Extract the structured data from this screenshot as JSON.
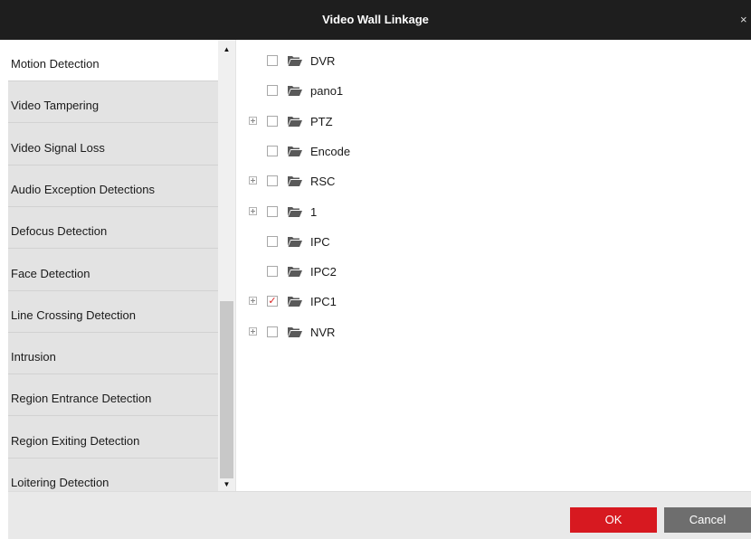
{
  "dialog": {
    "title": "Video Wall Linkage",
    "close_glyph": "×"
  },
  "sidebar": {
    "items": [
      {
        "label": "Motion Detection",
        "active": true
      },
      {
        "label": "Video Tampering",
        "active": false
      },
      {
        "label": "Video Signal Loss",
        "active": false
      },
      {
        "label": "Audio Exception Detections",
        "active": false
      },
      {
        "label": "Defocus Detection",
        "active": false
      },
      {
        "label": "Face Detection",
        "active": false
      },
      {
        "label": "Line Crossing Detection",
        "active": false
      },
      {
        "label": "Intrusion",
        "active": false
      },
      {
        "label": "Region Entrance Detection",
        "active": false
      },
      {
        "label": "Region Exiting Detection",
        "active": false
      },
      {
        "label": "Loitering Detection",
        "active": false
      }
    ],
    "scroll_up_glyph": "▲",
    "scroll_down_glyph": "▼"
  },
  "tree": {
    "nodes": [
      {
        "label": "DVR",
        "expandable": false,
        "checked": false,
        "icon": "folder-icon"
      },
      {
        "label": "pano1",
        "expandable": false,
        "checked": false,
        "icon": "folder-icon"
      },
      {
        "label": "PTZ",
        "expandable": true,
        "checked": false,
        "icon": "folder-icon"
      },
      {
        "label": "Encode",
        "expandable": false,
        "checked": false,
        "icon": "folder-icon"
      },
      {
        "label": "RSC",
        "expandable": true,
        "checked": false,
        "icon": "folder-icon"
      },
      {
        "label": "1",
        "expandable": true,
        "checked": false,
        "icon": "folder-icon"
      },
      {
        "label": "IPC",
        "expandable": false,
        "checked": false,
        "icon": "folder-icon"
      },
      {
        "label": "IPC2",
        "expandable": false,
        "checked": false,
        "icon": "folder-icon"
      },
      {
        "label": "IPC1",
        "expandable": true,
        "checked": true,
        "icon": "folder-icon"
      },
      {
        "label": "NVR",
        "expandable": true,
        "checked": false,
        "icon": "folder-icon"
      }
    ]
  },
  "footer": {
    "ok_label": "OK",
    "cancel_label": "Cancel"
  },
  "colors": {
    "titlebar": "#1e1e1e",
    "ok_button": "#d71920",
    "cancel_button": "#6e6e6e",
    "check_mark": "#d81e1e",
    "folder": "#5a5a5a"
  }
}
